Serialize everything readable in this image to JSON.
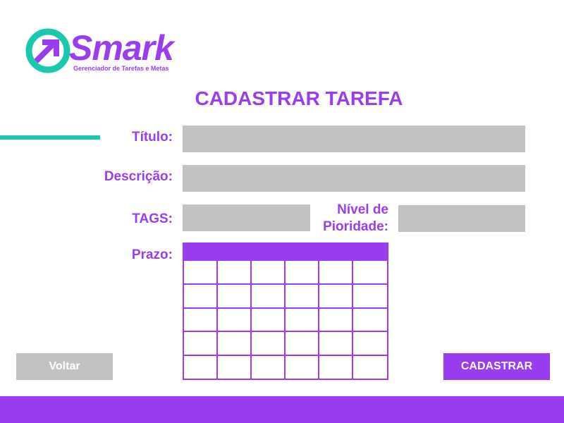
{
  "brand": {
    "name": "Smark",
    "tagline": "Gerenciador de Tarefas e Metas",
    "logo_icon": "arrow-circle-icon",
    "colors": {
      "primary": "#9a3df0",
      "accent": "#1ac8b0",
      "field": "#c2c2c2"
    }
  },
  "page": {
    "title": "CADASTRAR TAREFA"
  },
  "form": {
    "title_label": "Título:",
    "title_value": "",
    "description_label": "Descrição:",
    "description_value": "",
    "tags_label": "TAGS:",
    "tags_value": "",
    "priority_label_line1": "Nível de",
    "priority_label_line2": "Pioridade:",
    "priority_value": "",
    "deadline_label": "Prazo:"
  },
  "actions": {
    "back_label": "Voltar",
    "submit_label": "CADASTRAR"
  }
}
